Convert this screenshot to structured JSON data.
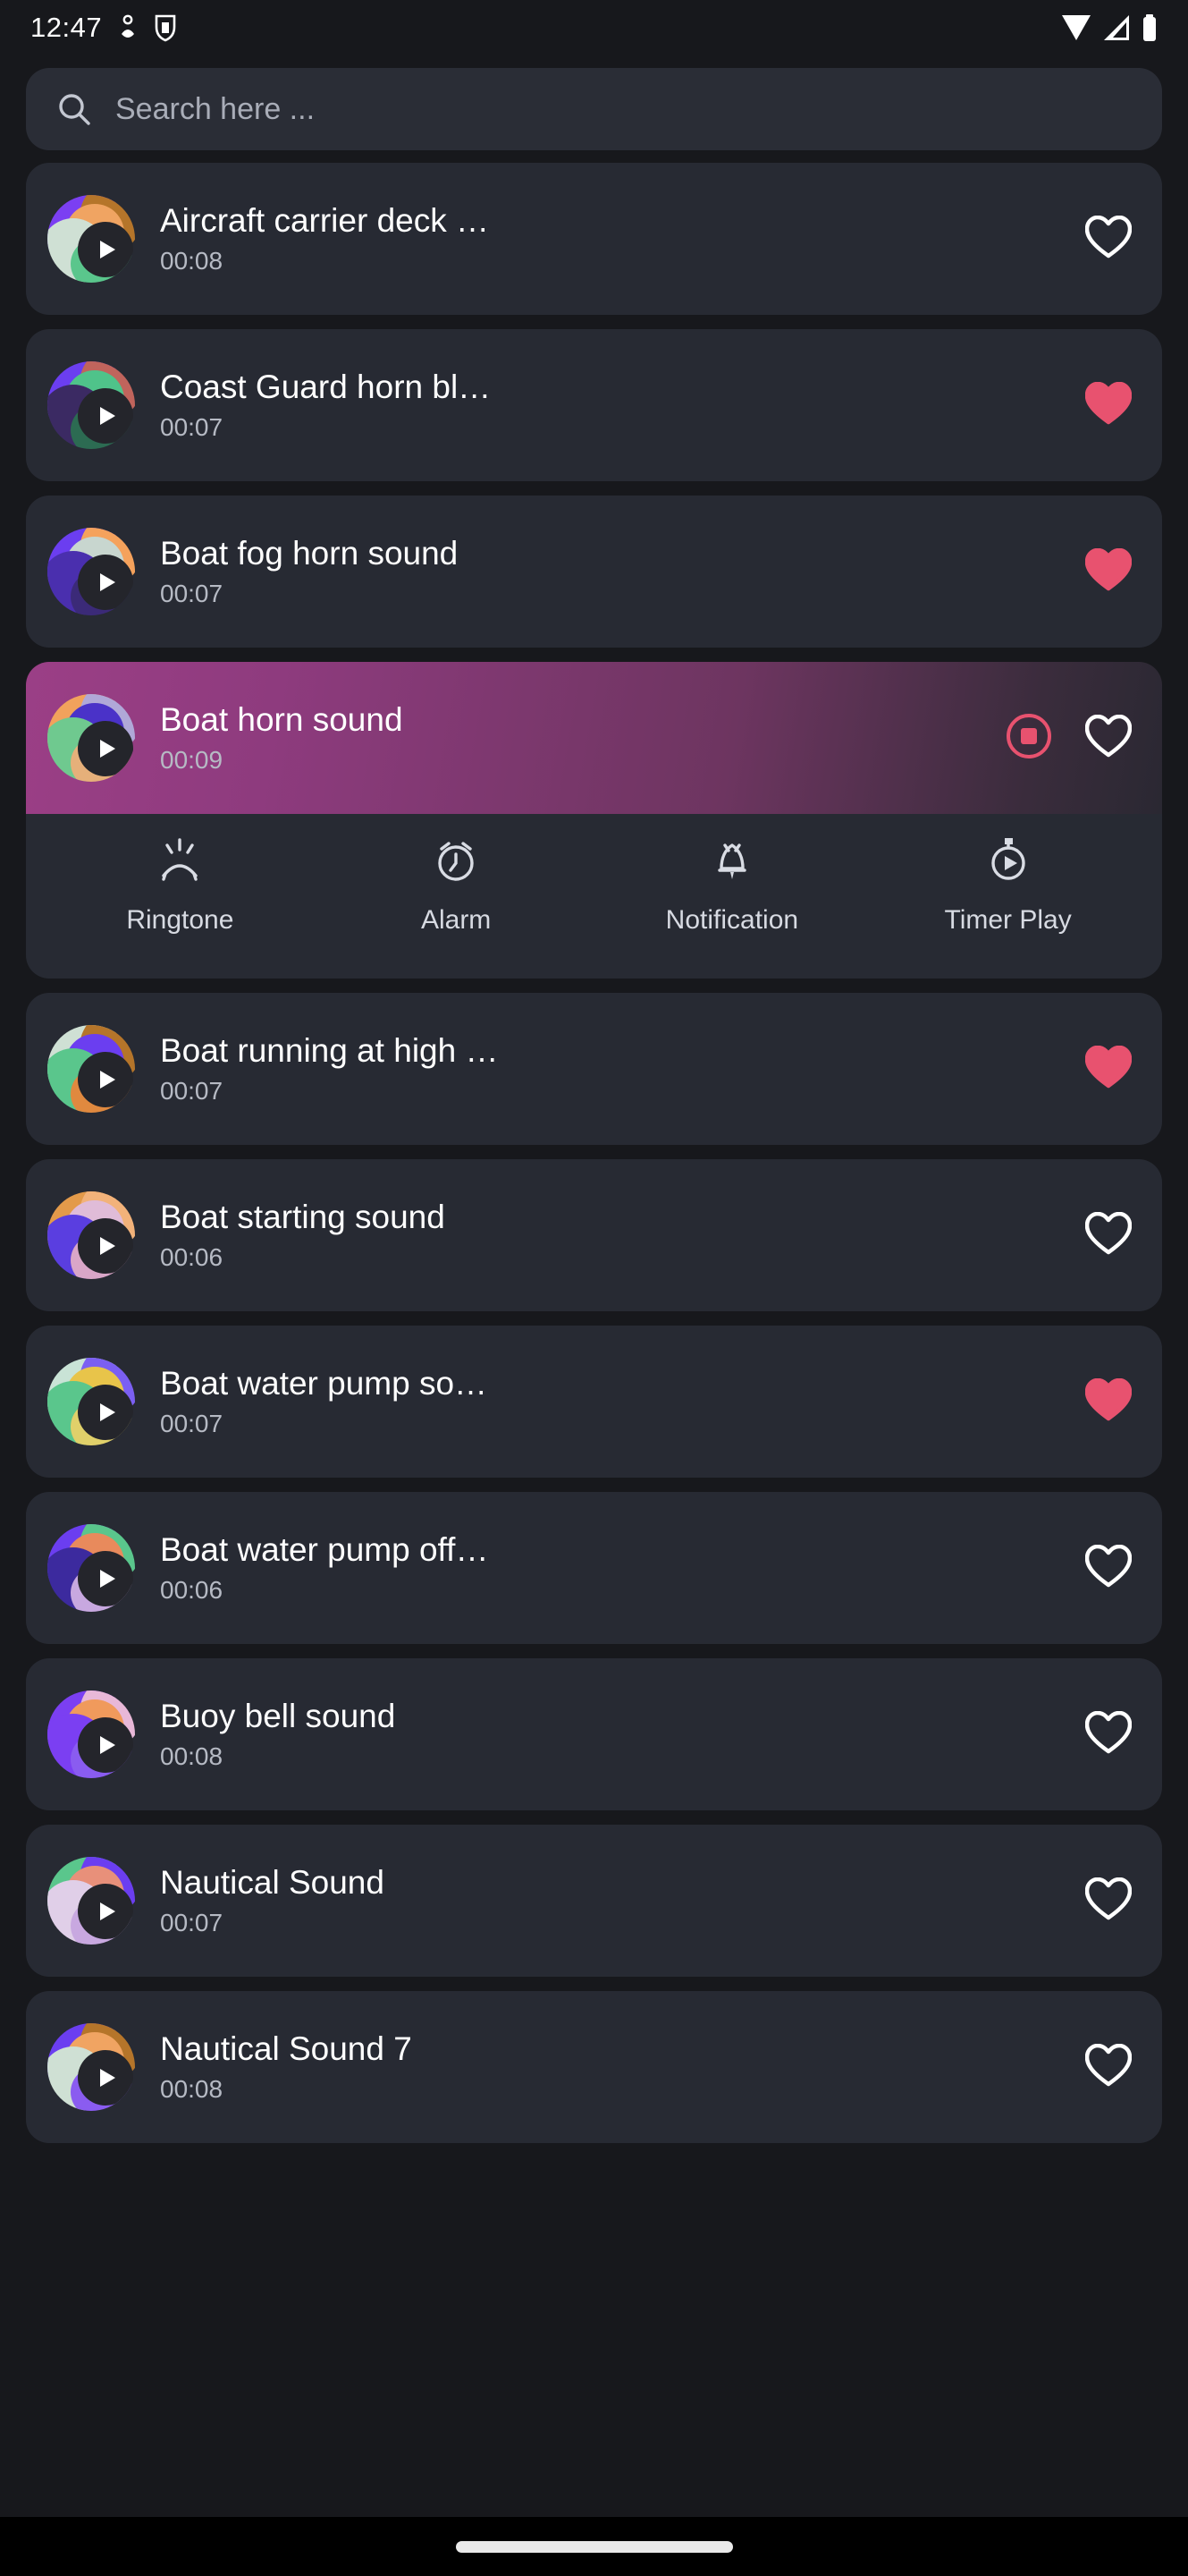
{
  "status_bar": {
    "time": "12:47",
    "icons_left": [
      "bluetooth-share-icon",
      "shield-vpn-icon"
    ],
    "icons_right": [
      "wifi-icon",
      "cellular-signal-icon",
      "battery-icon"
    ]
  },
  "search": {
    "placeholder": "Search here ...",
    "value": "",
    "icon": "search-icon"
  },
  "colors": {
    "background": "#17181c",
    "card": "#272a33",
    "search_field": "#2a2d36",
    "favorite_active": "#e8526f",
    "stop_accent": "#e8526f",
    "playing_gradient_start": "#9b3f86",
    "playing_gradient_end": "#2a2832",
    "text_primary": "#ffffff",
    "text_secondary": "#b6bac4"
  },
  "playing_actions": [
    {
      "label": "Ringtone",
      "icon": "ringtone-icon"
    },
    {
      "label": "Alarm",
      "icon": "alarm-clock-icon"
    },
    {
      "label": "Notification",
      "icon": "notification-bell-icon"
    },
    {
      "label": "Timer Play",
      "icon": "timer-play-icon"
    }
  ],
  "sounds": [
    {
      "title": "Aircraft carrier deck …",
      "duration": "00:08",
      "favorite": false,
      "playing": false,
      "thumb": [
        "#7b3ff2",
        "#b5752a",
        "#f0a462",
        "#cfe0d4",
        "#5ac68c"
      ]
    },
    {
      "title": "Coast Guard horn bl…",
      "duration": "00:07",
      "favorite": true,
      "playing": false,
      "thumb": [
        "#6b3ef0",
        "#c0645c",
        "#4fc38a",
        "#3b2a63",
        "#2c6b52"
      ]
    },
    {
      "title": "Boat fog horn sound",
      "duration": "00:07",
      "favorite": true,
      "playing": false,
      "thumb": [
        "#6b3ef0",
        "#f5a25c",
        "#c8d6cf",
        "#4a2fae",
        "#3b2a78"
      ]
    },
    {
      "title": "Boat horn sound",
      "duration": "00:09",
      "favorite": false,
      "playing": true,
      "thumb": [
        "#f2a25c",
        "#b0a8d8",
        "#4a32c8",
        "#6fc98f",
        "#e6b07a"
      ]
    },
    {
      "title": "Boat running at high …",
      "duration": "00:07",
      "favorite": true,
      "playing": false,
      "thumb": [
        "#cfe0d4",
        "#b5752a",
        "#6b3ef0",
        "#5ac68c",
        "#e0893f"
      ]
    },
    {
      "title": "Boat starting sound",
      "duration": "00:06",
      "favorite": false,
      "playing": false,
      "thumb": [
        "#e39a4a",
        "#f2b27a",
        "#e0bcd8",
        "#5a3ee0",
        "#d9a6c8"
      ]
    },
    {
      "title": "Boat water pump so…",
      "duration": "00:07",
      "favorite": true,
      "playing": false,
      "thumb": [
        "#c9e3d6",
        "#7b5ff2",
        "#e8c44a",
        "#5ac68c",
        "#e0d06a"
      ]
    },
    {
      "title": "Boat water pump off…",
      "duration": "00:06",
      "favorite": false,
      "playing": false,
      "thumb": [
        "#6b3ef0",
        "#5ac68c",
        "#e88a5c",
        "#3c2a9e",
        "#c8a8e0"
      ]
    },
    {
      "title": "Buoy bell sound",
      "duration": "00:08",
      "favorite": false,
      "playing": false,
      "thumb": [
        "#7b3ff2",
        "#e8b8d8",
        "#f09a5c",
        "#f2c martian",
        "#8a5cf0"
      ]
    },
    {
      "title": "Nautical Sound",
      "duration": "00:07",
      "favorite": false,
      "playing": false,
      "thumb": [
        "#5ac68c",
        "#6b3ef0",
        "#e8907a",
        "#e0cfe8",
        "#c8a8e0"
      ]
    },
    {
      "title": "Nautical Sound 7",
      "duration": "00:08",
      "favorite": false,
      "playing": false,
      "thumb": [
        "#6b3ef0",
        "#b5752a",
        "#f0a462",
        "#cfe0d4",
        "#8a5cf0"
      ]
    }
  ],
  "nav_bar": {
    "handle": "home-indicator"
  }
}
